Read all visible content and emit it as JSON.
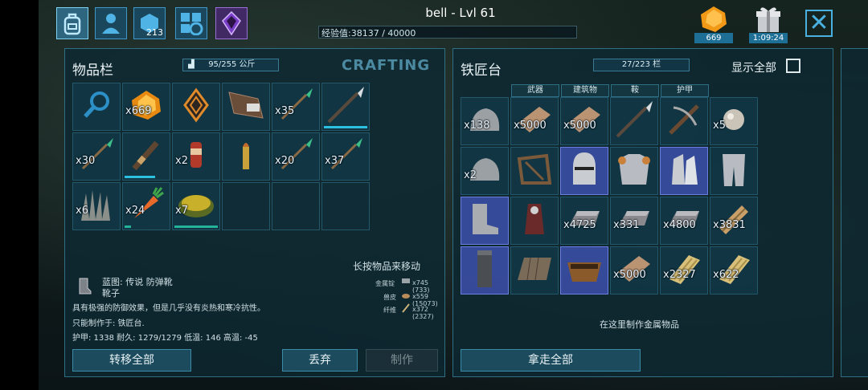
{
  "player": {
    "name": "bell - Lvl 61",
    "xp_label": "经验值",
    "xp_value": "38137 / 40000"
  },
  "top_nav": {
    "tribe_count": "213"
  },
  "resources": {
    "amber_count": "669",
    "gift_timer": "1:09:24"
  },
  "inventory": {
    "title": "物品栏",
    "weight": "95/255 公斤",
    "crafting_label": "CRAFTING",
    "hint": "长按物品来移动",
    "slots": [
      {
        "item": "search-slot",
        "qty": ""
      },
      {
        "item": "amber",
        "qty": "x669"
      },
      {
        "item": "implant",
        "qty": ""
      },
      {
        "item": "campfire",
        "qty": ""
      },
      {
        "item": "spear",
        "qty": "x35"
      },
      {
        "item": "pike",
        "qty": ""
      },
      {
        "item": "spear",
        "qty": "x30"
      },
      {
        "item": "club",
        "qty": ""
      },
      {
        "item": "flare",
        "qty": "x2"
      },
      {
        "item": "bullet",
        "qty": ""
      },
      {
        "item": "spear",
        "qty": "x20"
      },
      {
        "item": "spear",
        "qty": "x37"
      },
      {
        "item": "fiber",
        "qty": "x6"
      },
      {
        "item": "carrot",
        "qty": "x24"
      },
      {
        "item": "cake",
        "qty": "x7"
      }
    ]
  },
  "selected_item": {
    "blueprint": "蓝图: 传说 防弹靴",
    "name": "靴子",
    "description": "具有极强的防御效果，但是几乎没有炎热和寒冷抗性。",
    "craft_at": "只能制作于: 铁匠台.",
    "stats": "护甲: 1338  耐久: 1279/1279  低温: 146  高温: -45",
    "cost": [
      {
        "name": "金属锭",
        "value": "x745 (733)"
      },
      {
        "name": "兽皮",
        "value": "x559 (15073)"
      },
      {
        "name": "纤维",
        "value": "x372 (2327)"
      }
    ]
  },
  "inventory_buttons": {
    "transfer_all": "转移全部",
    "drop": "丢弃",
    "craft": "制作"
  },
  "smithy": {
    "title": "铁匠台",
    "weight": "27/223 栏",
    "show_all": "显示全部",
    "tabs": [
      "武器",
      "建筑物",
      "鞍",
      "护甲"
    ],
    "slots": [
      {
        "item": "stone",
        "qty": "x138",
        "blue": false
      },
      {
        "item": "hide",
        "qty": "x5000",
        "blue": false
      },
      {
        "item": "hide",
        "qty": "x5000",
        "blue": false
      },
      {
        "item": "pike",
        "qty": "",
        "blue": false
      },
      {
        "item": "crossbow",
        "qty": "",
        "blue": false
      },
      {
        "item": "ball",
        "qty": "x5",
        "blue": false
      },
      {
        "item": "stone",
        "qty": "x2",
        "blue": false
      },
      {
        "item": "saddle",
        "qty": "",
        "blue": false
      },
      {
        "item": "helmet",
        "qty": "",
        "blue": true
      },
      {
        "item": "chest",
        "qty": "",
        "blue": false
      },
      {
        "item": "gloves",
        "qty": "",
        "blue": true
      },
      {
        "item": "legs",
        "qty": "",
        "blue": false
      },
      {
        "item": "boots",
        "qty": "",
        "blue": true
      },
      {
        "item": "saddle2",
        "qty": "",
        "blue": false
      },
      {
        "item": "ingot",
        "qty": "x4725",
        "blue": false
      },
      {
        "item": "ingot",
        "qty": "x331",
        "blue": false
      },
      {
        "item": "ingot",
        "qty": "x4800",
        "blue": false
      },
      {
        "item": "wood",
        "qty": "x3831",
        "blue": false
      },
      {
        "item": "pillar",
        "qty": "",
        "blue": true
      },
      {
        "item": "floor",
        "qty": "",
        "blue": false
      },
      {
        "item": "trough",
        "qty": "",
        "blue": true
      },
      {
        "item": "hide",
        "qty": "x5000",
        "blue": false
      },
      {
        "item": "fiber2",
        "qty": "x2327",
        "blue": false
      },
      {
        "item": "fiber2",
        "qty": "x622",
        "blue": false
      }
    ],
    "footer_hint": "在这里制作金属物品"
  },
  "smithy_buttons": {
    "take_all": "拿走全部"
  },
  "colors": {
    "accent": "#3d97c8",
    "panel": "#0e2832",
    "blue_slot": "#3c50aa"
  }
}
